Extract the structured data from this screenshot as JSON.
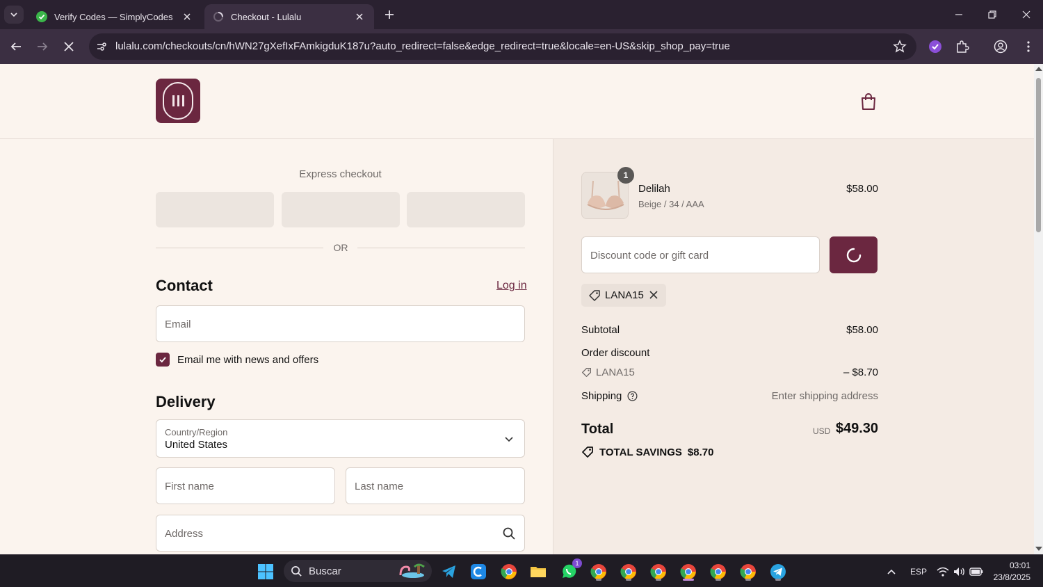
{
  "browser": {
    "tabs": [
      {
        "title": "Verify Codes — SimplyCodes",
        "favicon": "simplycodes-check-icon",
        "active": false
      },
      {
        "title": "Checkout - Lulalu",
        "favicon": "loading-spinner-icon",
        "active": true
      }
    ],
    "url": "lulalu.com/checkouts/cn/hWN27gXefIxFAmkigduK187u?auto_redirect=false&edge_redirect=true&locale=en-US&skip_shop_pay=true",
    "accent_color": "#3b2f42"
  },
  "brand": {
    "color": "#6b2740"
  },
  "checkout": {
    "express_title": "Express checkout",
    "or_label": "OR",
    "contact_heading": "Contact",
    "login_label": "Log in",
    "email_placeholder": "Email",
    "newsletter_label": "Email me with news and offers",
    "newsletter_checked": true,
    "delivery_heading": "Delivery",
    "country_label": "Country/Region",
    "country_value": "United States",
    "first_name_placeholder": "First name",
    "last_name_placeholder": "Last name",
    "address_placeholder": "Address"
  },
  "summary": {
    "item": {
      "name": "Delilah",
      "variant": "Beige / 34 / AAA",
      "price": "$58.00",
      "quantity": "1"
    },
    "discount_placeholder": "Discount code or gift card",
    "applied_code": "LANA15",
    "subtotal_label": "Subtotal",
    "subtotal_value": "$58.00",
    "order_discount_label": "Order discount",
    "discount_code": "LANA15",
    "discount_value": "– $8.70",
    "shipping_label": "Shipping",
    "shipping_value": "Enter shipping address",
    "total_label": "Total",
    "total_currency": "USD",
    "total_value": "$49.30",
    "savings_label": "TOTAL SAVINGS",
    "savings_value": "$8.70"
  },
  "taskbar": {
    "search_label": "Buscar",
    "language": "ESP",
    "time": "03:01",
    "date": "23/8/2025",
    "whatsapp_badge": "1"
  }
}
